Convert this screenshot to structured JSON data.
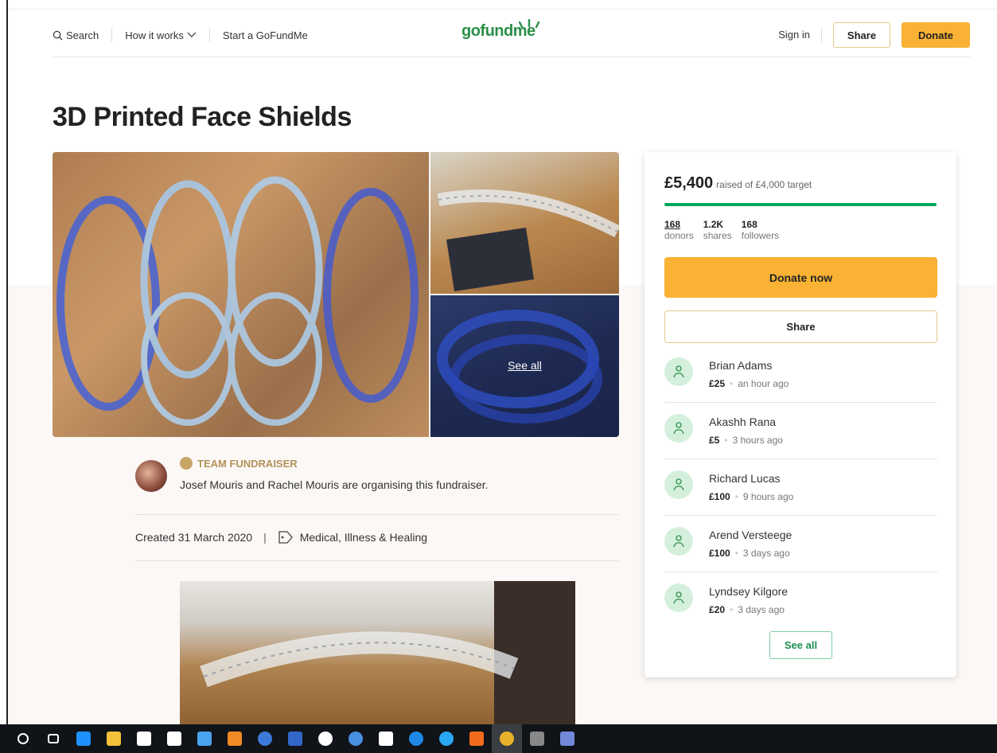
{
  "header": {
    "search_label": "Search",
    "how_it_works_label": "How it works",
    "start_label": "Start a GoFundMe",
    "logo_text": "gofundme",
    "signin_label": "Sign in",
    "share_label": "Share",
    "donate_label": "Donate"
  },
  "campaign": {
    "title": "3D Printed Face Shields",
    "see_all_photos": "See all",
    "organiser": {
      "badge": "TEAM FUNDRAISER",
      "text": "Josef Mouris and Rachel Mouris are organising this fundraiser."
    },
    "created": "Created 31 March 2020",
    "separator": "|",
    "category": "Medical, Illness & Healing"
  },
  "card": {
    "raised_amount": "£5,400",
    "raised_target": "raised of £4,000 target",
    "progress_fraction": 1.0,
    "stats": [
      {
        "num": "168",
        "label": "donors"
      },
      {
        "num": "1.2K",
        "label": "shares"
      },
      {
        "num": "168",
        "label": "followers"
      }
    ],
    "donate_now_label": "Donate now",
    "share_label": "Share",
    "donors": [
      {
        "name": "Brian Adams",
        "amount": "£25",
        "time": "an hour ago"
      },
      {
        "name": "Akashh Rana",
        "amount": "£5",
        "time": "3 hours ago"
      },
      {
        "name": "Richard Lucas",
        "amount": "£100",
        "time": "9 hours ago"
      },
      {
        "name": "Arend Versteege",
        "amount": "£100",
        "time": "3 days ago"
      },
      {
        "name": "Lyndsey Kilgore",
        "amount": "£20",
        "time": "3 days ago"
      }
    ],
    "see_all_label": "See all"
  },
  "colors": {
    "brand_green": "#02a95c",
    "donate_yellow": "#f9b234",
    "badge_gold": "#b2925a"
  },
  "taskbar": {
    "icons": [
      "cortana-icon",
      "task-view-icon",
      "edge-icon",
      "file-explorer-icon",
      "store-icon",
      "notepad-icon",
      "steam-icon",
      "vlc-icon",
      "app-icon",
      "app-icon-2",
      "app-icon-3",
      "app-icon-4",
      "app-icon-5",
      "mail-icon",
      "app-icon-6",
      "app-icon-7",
      "chrome-icon",
      "app-icon-8",
      "discord-icon"
    ]
  }
}
